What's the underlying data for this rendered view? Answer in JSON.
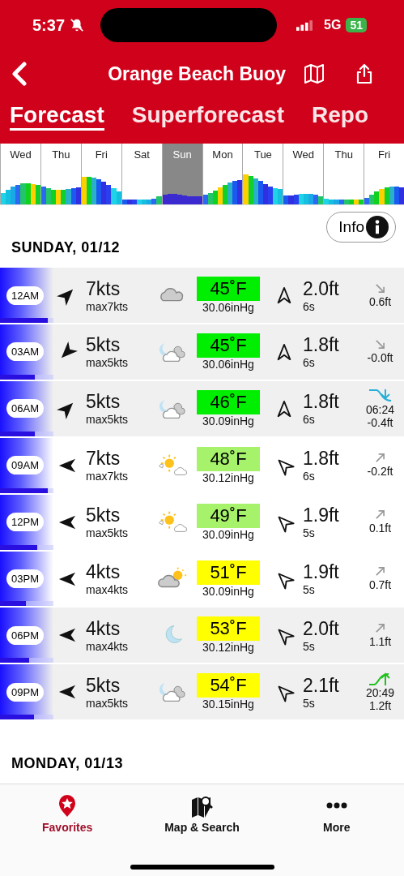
{
  "status_bar": {
    "time": "5:37",
    "network": "5G",
    "battery": "51"
  },
  "nav": {
    "title": "Orange Beach Buoy"
  },
  "tabs": [
    {
      "label": "Forecast",
      "selected": true
    },
    {
      "label": "Superforecast",
      "selected": false
    },
    {
      "label": "Repo",
      "selected": false
    }
  ],
  "days": [
    {
      "label": "Wed",
      "selected": false
    },
    {
      "label": "Thu",
      "selected": false
    },
    {
      "label": "Fri",
      "selected": false
    },
    {
      "label": "Sat",
      "selected": false
    },
    {
      "label": "Sun",
      "selected": true
    },
    {
      "label": "Mon",
      "selected": false
    },
    {
      "label": "Tue",
      "selected": false
    },
    {
      "label": "Wed",
      "selected": false
    },
    {
      "label": "Thu",
      "selected": false
    },
    {
      "label": "Fri",
      "selected": false
    }
  ],
  "info_button": "Info",
  "sections": [
    {
      "title": "SUNDAY, 01/12",
      "rows": [
        {
          "time": "12AM",
          "daytime": false,
          "level": 0.9,
          "kind": "cloudy",
          "wind": {
            "kind": "NE",
            "speed": "7kts",
            "gust": "max7kts"
          },
          "temp": "45˚F",
          "color": "#00ee00",
          "pressure": "30.06inHg",
          "swell": {
            "kind": "N",
            "height": "2.0ft",
            "period": "6s"
          },
          "tide": {
            "kind": "falling",
            "height": "0.6ft"
          }
        },
        {
          "time": "03AM",
          "daytime": false,
          "level": 0.65,
          "kind": "cloudy-night",
          "wind": {
            "kind": "SW",
            "speed": "5kts",
            "gust": "max5kts"
          },
          "temp": "45˚F",
          "color": "#00ee00",
          "pressure": "30.06inHg",
          "swell": {
            "kind": "N",
            "height": "1.8ft",
            "period": "6s"
          },
          "tide": {
            "kind": "falling",
            "height": "-0.0ft"
          }
        },
        {
          "time": "06AM",
          "daytime": false,
          "level": 0.65,
          "kind": "cloudy-night",
          "wind": {
            "kind": "NE",
            "speed": "5kts",
            "gust": "max5kts"
          },
          "temp": "46˚F",
          "color": "#00ee00",
          "pressure": "30.09inHg",
          "swell": {
            "kind": "N",
            "height": "1.8ft",
            "period": "6s"
          },
          "tide": {
            "kind": "low",
            "time": "06:24",
            "height": "-0.4ft"
          }
        },
        {
          "time": "09AM",
          "daytime": true,
          "level": 0.9,
          "kind": "sun-cloud",
          "wind": {
            "kind": "W",
            "speed": "7kts",
            "gust": "max7kts"
          },
          "temp": "48˚F",
          "color": "#a6f26a",
          "pressure": "30.12inHg",
          "swell": {
            "kind": "NW",
            "height": "1.8ft",
            "period": "6s"
          },
          "tide": {
            "kind": "rising",
            "height": "-0.2ft"
          }
        },
        {
          "time": "12PM",
          "daytime": true,
          "level": 0.7,
          "kind": "sun-cloud",
          "wind": {
            "kind": "W",
            "speed": "5kts",
            "gust": "max5kts"
          },
          "temp": "49˚F",
          "color": "#a6f26a",
          "pressure": "30.09inHg",
          "swell": {
            "kind": "NW",
            "height": "1.9ft",
            "period": "5s"
          },
          "tide": {
            "kind": "rising",
            "height": "0.1ft"
          }
        },
        {
          "time": "03PM",
          "daytime": true,
          "level": 0.48,
          "kind": "cloud-sun",
          "wind": {
            "kind": "W",
            "speed": "4kts",
            "gust": "max4kts"
          },
          "temp": "51˚F",
          "color": "#ffff00",
          "pressure": "30.09inHg",
          "swell": {
            "kind": "NW",
            "height": "1.9ft",
            "period": "5s"
          },
          "tide": {
            "kind": "rising",
            "height": "0.7ft"
          }
        },
        {
          "time": "06PM",
          "daytime": false,
          "level": 0.55,
          "kind": "moon",
          "wind": {
            "kind": "W",
            "speed": "4kts",
            "gust": "max4kts"
          },
          "temp": "53˚F",
          "color": "#ffff00",
          "pressure": "30.12inHg",
          "swell": {
            "kind": "NW",
            "height": "2.0ft",
            "period": "5s"
          },
          "tide": {
            "kind": "rising",
            "height": "1.1ft"
          }
        },
        {
          "time": "09PM",
          "daytime": false,
          "level": 0.64,
          "kind": "cloudy-night",
          "wind": {
            "kind": "W",
            "speed": "5kts",
            "gust": "max5kts"
          },
          "temp": "54˚F",
          "color": "#ffff00",
          "pressure": "30.15inHg",
          "swell": {
            "kind": "NW",
            "height": "2.1ft",
            "period": "5s"
          },
          "tide": {
            "kind": "high",
            "time": "20:49",
            "height": "1.2ft"
          }
        }
      ]
    },
    {
      "title": "MONDAY, 01/13"
    }
  ],
  "tab_bar": [
    {
      "label": "Favorites",
      "selected": true
    },
    {
      "label": "Map & Search",
      "selected": false
    },
    {
      "label": "More",
      "selected": false
    }
  ]
}
